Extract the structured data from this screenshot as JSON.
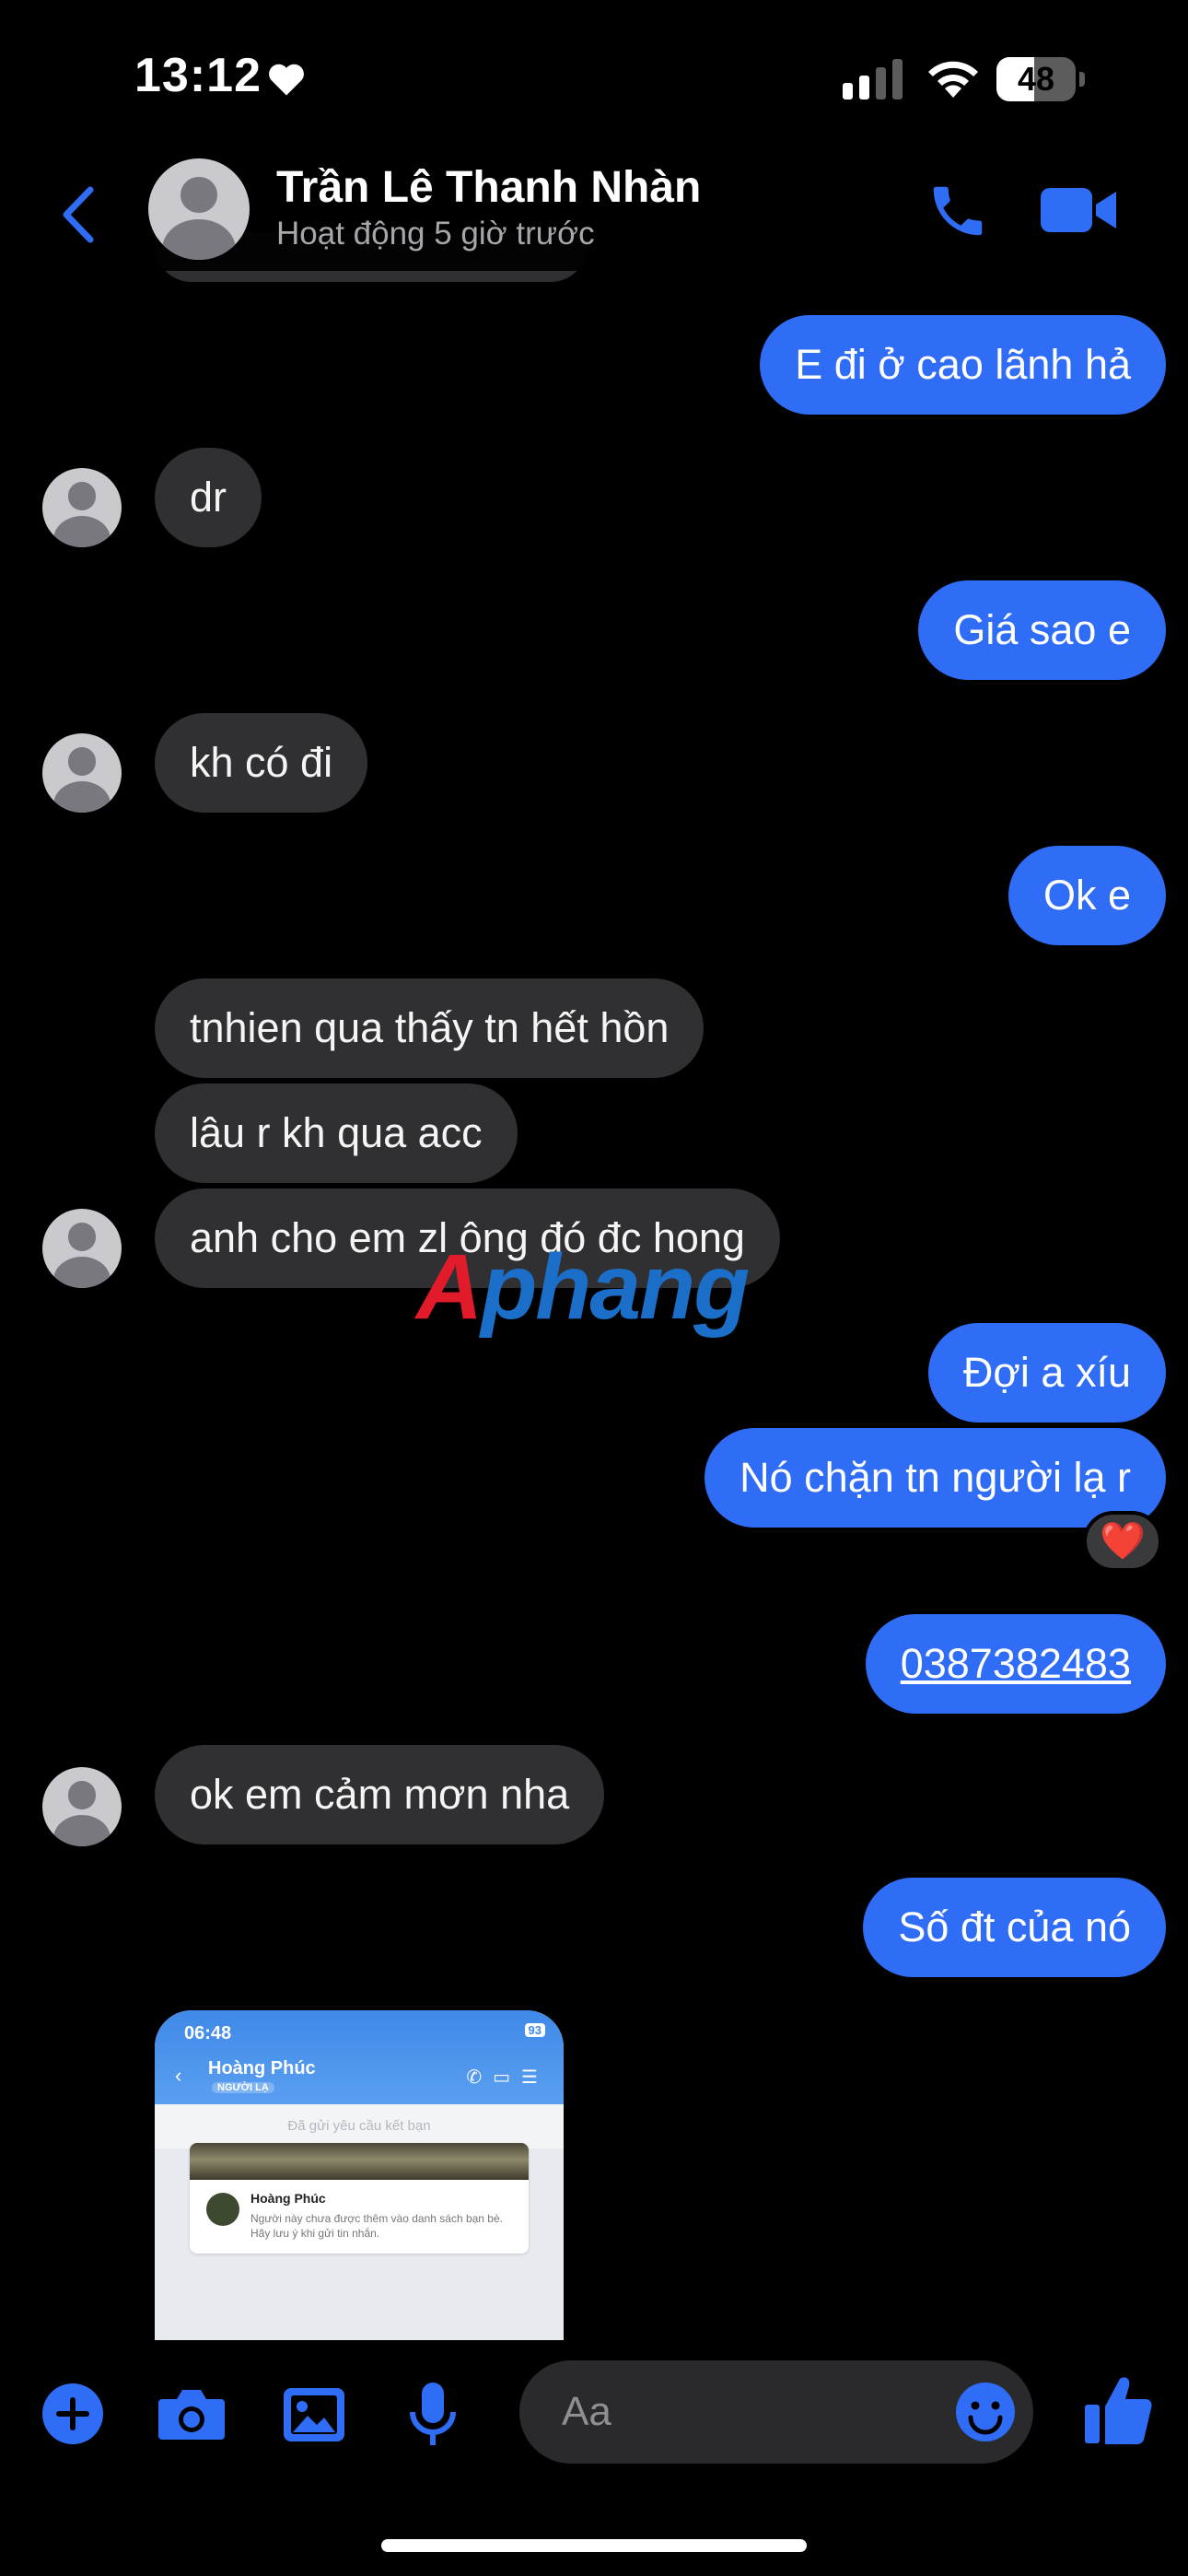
{
  "status_bar": {
    "time": "13:12",
    "battery_level": "48",
    "battery_fraction": 0.48
  },
  "header": {
    "contact_name": "Trần Lê Thanh Nhàn",
    "contact_status": "Hoạt động 5 giờ trước"
  },
  "messages": [
    {
      "direction": "outgoing",
      "text": "E đi ở cao lãnh hả"
    },
    {
      "direction": "incoming",
      "text": "dr"
    },
    {
      "direction": "outgoing",
      "text": "Giá sao e"
    },
    {
      "direction": "incoming",
      "text": "kh có đi"
    },
    {
      "direction": "outgoing",
      "text": "Ok e"
    },
    {
      "direction": "incoming",
      "text": "tnhien qua thấy tn hết hồn"
    },
    {
      "direction": "incoming",
      "text": "lâu r kh qua acc"
    },
    {
      "direction": "incoming",
      "text": "anh cho em zl ông đó đc hong"
    },
    {
      "direction": "outgoing",
      "text": "Đợi a xíu"
    },
    {
      "direction": "outgoing",
      "text": "Nó chặn tn người lạ r",
      "reaction": "❤️"
    },
    {
      "direction": "outgoing",
      "text": "0387382483"
    },
    {
      "direction": "incoming",
      "text": "ok em cảm mơn nha"
    },
    {
      "direction": "outgoing",
      "text": "Số đt của nó"
    }
  ],
  "watermark": {
    "lead": "A",
    "rest": "phang"
  },
  "shared_image": {
    "time": "06:48",
    "battery": "93",
    "name": "Hoàng Phúc",
    "badge": "NGƯỜI LẠ",
    "notice": "Đã gửi yêu cầu kết bạn",
    "card_name": "Hoàng Phúc",
    "card_text": "Người này chưa được thêm vào danh sách bạn bè. Hãy lưu ý khi gửi tin nhắn."
  },
  "composer": {
    "placeholder": "Aa"
  },
  "icons": {
    "back": "chevron-left-icon",
    "call": "phone-icon",
    "video": "video-camera-icon",
    "add": "plus-circle-icon",
    "camera": "camera-icon",
    "gallery": "image-icon",
    "mic": "microphone-icon",
    "emoji": "smile-icon",
    "like": "thumbs-up-icon"
  },
  "colors": {
    "accent": "#2f6df6",
    "incoming_bubble": "#303033",
    "background": "#000000"
  }
}
